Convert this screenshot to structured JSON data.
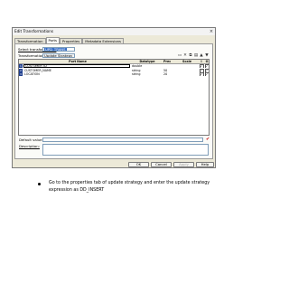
{
  "dialog": {
    "title": "Edit Transformations",
    "close_glyph": "×",
    "tabs": [
      "Transformation",
      "Ports",
      "Properties",
      "Metadata Extensions"
    ],
    "active_tab": "Ports",
    "select_transformation_label": "Select transformation:",
    "select_transformation_value": "UPD_TRANS",
    "transformation_type_label": "Transformation type:",
    "transformation_type_value": "Update Strategy",
    "toolbar_icons": [
      "new-port-icon",
      "delete-port-icon",
      "copy-icon",
      "paste-icon",
      "move-up-icon",
      "move-down-icon"
    ],
    "table": {
      "columns": [
        "Port Name",
        "Datatype",
        "Prec",
        "Scale",
        "I",
        "O"
      ],
      "rows": [
        {
          "num": "1",
          "name": "CUSTOMER_ID",
          "datatype": "double",
          "prec": "",
          "scale": "",
          "i": "✓",
          "o": "✓"
        },
        {
          "num": "2",
          "name": "CUSTOMER_NAME",
          "datatype": "string",
          "prec": "50",
          "scale": "",
          "i": "✓",
          "o": "✓"
        },
        {
          "num": "3",
          "name": "LOCATION",
          "datatype": "string",
          "prec": "20",
          "scale": "",
          "i": "✓",
          "o": "✓"
        }
      ]
    },
    "default_value_label": "Default value:",
    "default_value": "",
    "description_label": "Description:",
    "description_value": "",
    "buttons": {
      "ok": "OK",
      "cancel": "Cancel",
      "apply": "Apply",
      "help": "Help"
    }
  },
  "instruction": "Go to the properties tab of update strategy and enter the update strategy expression as DD_INSERT"
}
